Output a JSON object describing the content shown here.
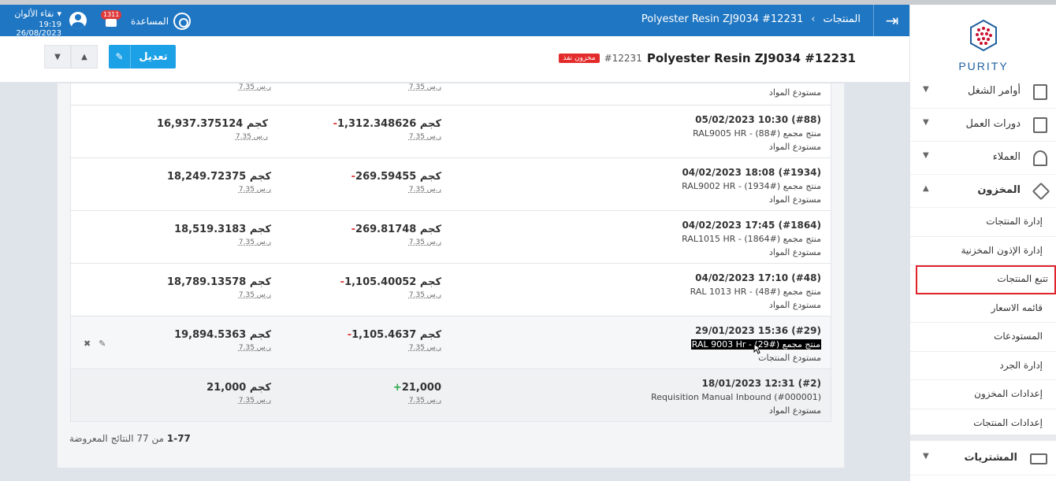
{
  "header": {
    "breadcrumb_products": "المنتجات",
    "breadcrumb_item": "Polyester Resin ZJ9034 #12231",
    "help": "المساعدة",
    "notif_count": "1311",
    "user_name": "نقاء الألوان",
    "user_time": "19:19 26/08/2023"
  },
  "title": {
    "main": "Polyester Resin ZJ9034 #12231",
    "code": "#12231",
    "stock_badge": "مخزون نفذ",
    "edit_label": "تعديل"
  },
  "rows": [
    {
      "date": "",
      "product": "",
      "warehouse": "مستودع المواد",
      "qty": "",
      "qty_sign": "",
      "qty_price": "7.35 ر.س",
      "balance": "",
      "bal_price": "7.35 ر.س"
    },
    {
      "date": "(#88) 10:30 05/02/2023",
      "product": "منتج مجمع (#88) - RAL9005 HR",
      "warehouse": "مستودع المواد",
      "qty": "1,312.348626 كجم",
      "qty_sign": "-",
      "qty_price": "7.35 ر.س",
      "balance": "16,937.375124 كجم",
      "bal_price": "7.35 ر.س"
    },
    {
      "date": "(#1934) 18:08 04/02/2023",
      "product": "منتج مجمع (#1934) - RAL9002 HR",
      "warehouse": "مستودع المواد",
      "qty": "269.59455 كجم",
      "qty_sign": "-",
      "qty_price": "7.35 ر.س",
      "balance": "18,249.72375 كجم",
      "bal_price": "7.35 ر.س"
    },
    {
      "date": "(#1864) 17:45 04/02/2023",
      "product": "منتج مجمع (#1864) - RAL1015 HR",
      "warehouse": "مستودع المواد",
      "qty": "269.81748 كجم",
      "qty_sign": "-",
      "qty_price": "7.35 ر.س",
      "balance": "18,519.3183 كجم",
      "bal_price": "7.35 ر.س"
    },
    {
      "date": "(#48) 17:10 04/02/2023",
      "product": "منتج مجمع (#48) - RAL 1013 HR",
      "warehouse": "مستودع المواد",
      "qty": "1,105.40052 كجم",
      "qty_sign": "-",
      "qty_price": "7.35 ر.س",
      "balance": "18,789.13578 كجم",
      "bal_price": "7.35 ر.س"
    },
    {
      "date": "(#29) 15:36 29/01/2023",
      "product": "منتج مجمع (#29) - RAL 9003 Hr",
      "warehouse": "مستودع المنتجات",
      "qty": "1,105.4637 كجم",
      "qty_sign": "-",
      "qty_price": "7.35 ر.س",
      "balance": "19,894.5363 كجم",
      "bal_price": "7.35 ر.س"
    },
    {
      "date": "(#2) 12:31 18/01/2023",
      "product": "Requisition Manual Inbound (#000001)",
      "warehouse": "مستودع المواد",
      "qty": "21,000",
      "qty_sign": "+",
      "qty_price": "7.35 ر.س",
      "balance": "21,000 كجم",
      "bal_price": "7.35 ر.س"
    }
  ],
  "pager": {
    "range": "1-77",
    "text": "من 77 النتائج المعروضة"
  },
  "sidebar": {
    "logo": "PURITY",
    "items": [
      {
        "label": "أوامر الشغل",
        "icon": "clipboard-icon"
      },
      {
        "label": "دورات العمل",
        "icon": "clipboard-icon"
      },
      {
        "label": "العملاء",
        "icon": "users-icon"
      },
      {
        "label": "المخزون",
        "icon": "box-icon"
      }
    ],
    "subitems": [
      "إدارة المنتجات",
      "إدارة الإذون المخزنية",
      "تتبع المنتجات",
      "قائمه الاسعار",
      "المستودعات",
      "إدارة الجرد",
      "إعدادات المخزون",
      "إعدادات المنتجات"
    ],
    "purchases": "المشتريات"
  },
  "colors": {
    "header": "#1f76c2",
    "edit_button": "#1da1e6",
    "stock_badge": "#e42b2b",
    "active_outline": "#e0232b",
    "minus": "#e24040",
    "plus": "#2aa84a"
  }
}
